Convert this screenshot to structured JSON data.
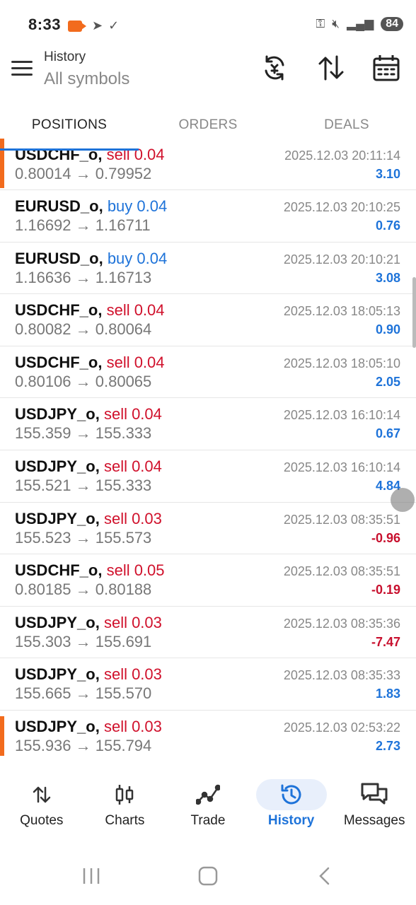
{
  "status": {
    "time": "8:33",
    "battery": "84"
  },
  "header": {
    "title": "History",
    "subtitle": "All symbols"
  },
  "tabs": [
    {
      "label": "POSITIONS",
      "active": true
    },
    {
      "label": "ORDERS",
      "active": false
    },
    {
      "label": "DEALS",
      "active": false
    }
  ],
  "positions": [
    {
      "symbol": "USDCHF_o,",
      "side": "sell 0.04",
      "prices": "0.80014 → 0.79952",
      "time": "2025.12.03 20:11:14",
      "profit": "3.10"
    },
    {
      "symbol": "EURUSD_o,",
      "side": "buy 0.04",
      "prices": "1.16692 → 1.16711",
      "time": "2025.12.03 20:10:25",
      "profit": "0.76"
    },
    {
      "symbol": "EURUSD_o,",
      "side": "buy 0.04",
      "prices": "1.16636 → 1.16713",
      "time": "2025.12.03 20:10:21",
      "profit": "3.08"
    },
    {
      "symbol": "USDCHF_o,",
      "side": "sell 0.04",
      "prices": "0.80082 → 0.80064",
      "time": "2025.12.03 18:05:13",
      "profit": "0.90"
    },
    {
      "symbol": "USDCHF_o,",
      "side": "sell 0.04",
      "prices": "0.80106 → 0.80065",
      "time": "2025.12.03 18:05:10",
      "profit": "2.05"
    },
    {
      "symbol": "USDJPY_o,",
      "side": "sell 0.04",
      "prices": "155.359 → 155.333",
      "time": "2025.12.03 16:10:14",
      "profit": "0.67"
    },
    {
      "symbol": "USDJPY_o,",
      "side": "sell 0.04",
      "prices": "155.521 → 155.333",
      "time": "2025.12.03 16:10:14",
      "profit": "4.84"
    },
    {
      "symbol": "USDJPY_o,",
      "side": "sell 0.03",
      "prices": "155.523 → 155.573",
      "time": "2025.12.03 08:35:51",
      "profit": "-0.96"
    },
    {
      "symbol": "USDCHF_o,",
      "side": "sell 0.05",
      "prices": "0.80185 → 0.80188",
      "time": "2025.12.03 08:35:51",
      "profit": "-0.19"
    },
    {
      "symbol": "USDJPY_o,",
      "side": "sell 0.03",
      "prices": "155.303 → 155.691",
      "time": "2025.12.03 08:35:36",
      "profit": "-7.47"
    },
    {
      "symbol": "USDJPY_o,",
      "side": "sell 0.03",
      "prices": "155.665 → 155.570",
      "time": "2025.12.03 08:35:33",
      "profit": "1.83"
    },
    {
      "symbol": "USDJPY_o,",
      "side": "sell 0.03",
      "prices": "155.936 → 155.794",
      "time": "2025.12.03 02:53:22",
      "profit": "2.73"
    }
  ],
  "bottom_nav": [
    {
      "label": "Quotes",
      "icon": "quotes-arrows-icon",
      "active": false
    },
    {
      "label": "Charts",
      "icon": "candlestick-icon",
      "active": false
    },
    {
      "label": "Trade",
      "icon": "trade-line-icon",
      "active": false
    },
    {
      "label": "History",
      "icon": "history-clock-icon",
      "active": true
    },
    {
      "label": "Messages",
      "icon": "messages-icon",
      "active": false
    }
  ],
  "colors": {
    "accent": "#1e73d9",
    "sell": "#d0102b",
    "marker": "#f26b1d"
  }
}
